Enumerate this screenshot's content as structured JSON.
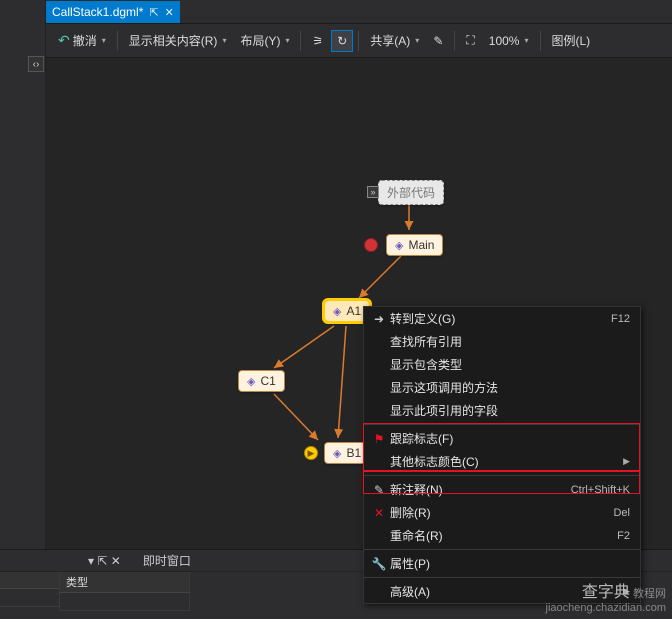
{
  "tab": {
    "title": "CallStack1.dgml*",
    "pin": "⇱",
    "close": "✕"
  },
  "toolbar": {
    "undo": "撤消",
    "related": "显示相关内容(R)",
    "layout": "布局(Y)",
    "share": "共享(A)",
    "zoom": "100%",
    "legend": "图例(L)"
  },
  "nodes": {
    "ext": "外部代码",
    "main": "Main",
    "a1": "A1",
    "c1": "C1",
    "b1": "B1"
  },
  "ctx": {
    "goto": "转到定义(G)",
    "goto_key": "F12",
    "findrefs": "查找所有引用",
    "showtypes": "显示包含类型",
    "showcallers": "显示这项调用的方法",
    "showfields": "显示此项引用的字段",
    "flag": "跟踪标志(F)",
    "flagcolor": "其他标志颜色(C)",
    "newcomment": "新注释(N)",
    "newcomment_key": "Ctrl+Shift+K",
    "delete": "删除(R)",
    "delete_key": "Del",
    "rename": "重命名(R)",
    "rename_key": "F2",
    "props": "属性(P)",
    "advanced": "高级(A)"
  },
  "bottom": {
    "immediate": "即时窗口",
    "type_col": "类型"
  },
  "watermark": {
    "line1": "查字典",
    "line2": "教程网",
    "line3": "jiaocheng.chazidian.com"
  }
}
